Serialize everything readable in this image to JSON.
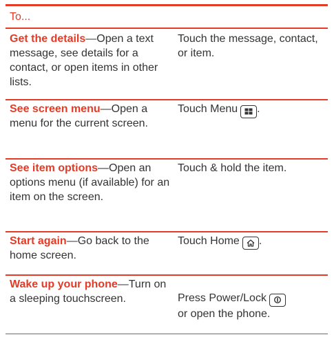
{
  "table": {
    "header": "To...",
    "rows": [
      {
        "term": "Get the details",
        "desc": "—Open a text message, see details for a contact, or open items in other lists.",
        "action": "Touch the message, contact, or item.",
        "action_suffix": "",
        "icon": null
      },
      {
        "term": "See screen menu",
        "desc": "—Open a menu for the current screen.",
        "action": "Touch Menu",
        "action_suffix": ".",
        "icon": "menu-key-icon"
      },
      {
        "term": "See item options",
        "desc": "—Open an options menu (if available) for an item on the screen.",
        "action": "Touch & hold the item.",
        "action_suffix": "",
        "icon": null
      },
      {
        "term": "Start again",
        "desc": "—Go back to the home screen.",
        "action": "Touch Home",
        "action_suffix": ".",
        "icon": "home-key-icon"
      },
      {
        "term": "Wake up your phone",
        "desc": "—Turn on a sleeping touchscreen.",
        "action": "Press Power/Lock",
        "action_suffix": "or open the phone.",
        "icon": "power-key-icon"
      }
    ]
  },
  "colors": {
    "accent": "#e53a26",
    "text": "#333333"
  }
}
